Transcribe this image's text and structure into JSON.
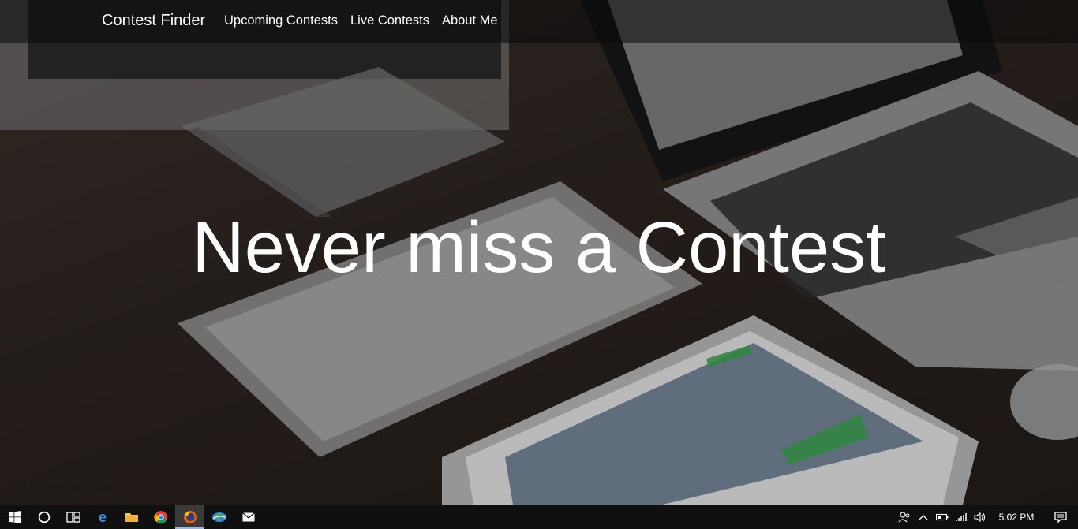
{
  "navbar": {
    "brand": "Contest Finder",
    "links": [
      "Upcoming Contests",
      "Live Contests",
      "About Me"
    ]
  },
  "hero": {
    "headline": "Never miss a Contest",
    "credit": "© DragonFist"
  },
  "taskbar": {
    "apps": [
      "windows-start-icon",
      "cortana-search-icon",
      "task-view-icon",
      "edge-icon",
      "file-explorer-icon",
      "chrome-icon",
      "firefox-icon",
      "google-earth-icon",
      "mail-icon"
    ],
    "active_app": "firefox-icon",
    "clock": "5:02 PM"
  },
  "colors": {
    "text": "#ffffff",
    "taskbar": "#101010",
    "navbar_overlay": "rgba(10,10,10,0.55)"
  }
}
